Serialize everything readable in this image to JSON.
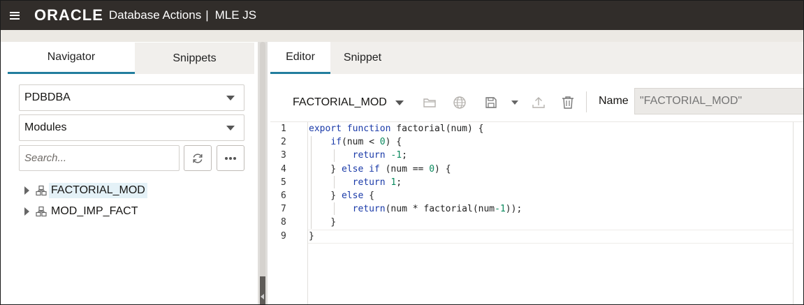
{
  "header": {
    "logo": "ORACLE",
    "app_title": "Database Actions",
    "separator": "|",
    "page": "MLE JS"
  },
  "navigator": {
    "tabs": [
      {
        "label": "Navigator",
        "active": true
      },
      {
        "label": "Snippets",
        "active": false
      }
    ],
    "schema_select": "PDBDBA",
    "type_select": "Modules",
    "search_placeholder": "Search...",
    "tree": [
      {
        "label": "FACTORIAL_MOD",
        "selected": true
      },
      {
        "label": "MOD_IMP_FACT",
        "selected": false
      }
    ]
  },
  "editor": {
    "tabs": [
      {
        "label": "Editor",
        "active": true
      },
      {
        "label": "Snippet",
        "active": false
      }
    ],
    "module_select": "FACTORIAL_MOD",
    "name_label": "Name",
    "name_placeholder": "\"FACTORIAL_MOD\"",
    "line_numbers": [
      "1",
      "2",
      "3",
      "4",
      "5",
      "6",
      "7",
      "8",
      "9"
    ],
    "code": [
      "export function factorial(num) {",
      "    if(num < 0) {",
      "        return -1;",
      "    } else if (num == 0) {",
      "        return 1;",
      "    } else {",
      "        return(num * factorial(num-1));",
      "    }",
      "}"
    ]
  },
  "colors": {
    "header_bg": "#312d2a",
    "accent": "#227e9e",
    "keyword": "#1a3aa8",
    "number": "#0b8a5e"
  }
}
